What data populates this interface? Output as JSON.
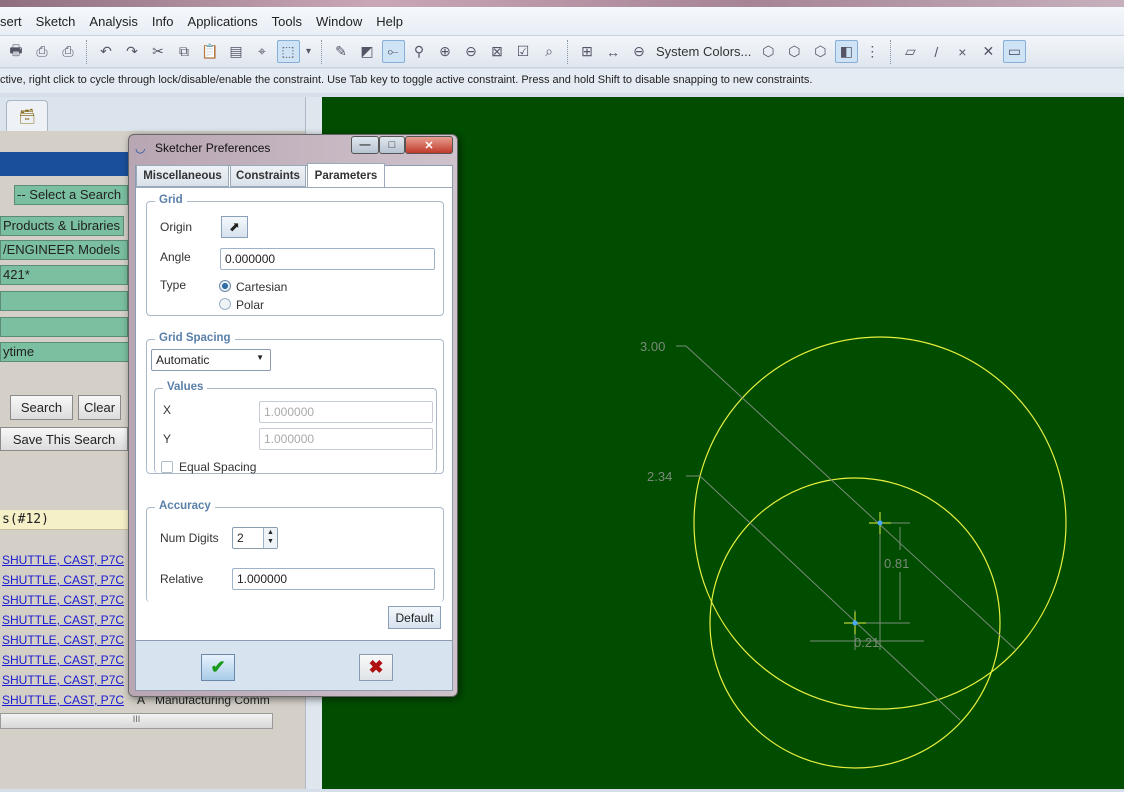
{
  "menu": [
    "sert",
    "Sketch",
    "Analysis",
    "Info",
    "Applications",
    "Tools",
    "Window",
    "Help"
  ],
  "toolbar": {
    "group1": [
      "print-icon",
      "attach-icon",
      "print-preview-icon"
    ],
    "group2": [
      "undo-icon",
      "redo-icon",
      "cut-icon",
      "copy-icon",
      "paste-icon",
      "paste-special-icon",
      "find-icon",
      "select-box-icon",
      "dropdown-arrow-icon"
    ],
    "group3": [
      "sketch-setup-icon",
      "sketch-view-icon",
      "constraint-icon",
      "find-constraints-icon",
      "zoom-in-icon",
      "zoom-out-icon",
      "refit-icon",
      "windows-icon",
      "zoom-window-icon"
    ],
    "group4": [
      "grid-icon",
      "dimension-icon",
      "ruler-icon"
    ],
    "system_colors": "System Colors...",
    "group5": [
      "wireframe-icon",
      "hidden-line-icon",
      "no-hidden-icon",
      "shading-icon",
      "tree-icon"
    ],
    "group6": [
      "datum-plane-icon",
      "datum-axis-icon",
      "datum-point-icon",
      "csys-icon",
      "annotation-icon"
    ]
  },
  "message": "ctive, right click to cycle through lock/disable/enable the constraint. Use Tab key to toggle active constraint. Press and hold Shift to disable snapping to new constraints.",
  "left_panel": {
    "fields": [
      "-- Select a Search",
      "Products & Libraries",
      "/ENGINEER Models",
      "421*",
      "",
      "",
      "ytime"
    ],
    "search_button": "Search",
    "clear_button": "Clear",
    "save_button": "Save This Search",
    "results_header": "s(#12)",
    "results": [
      "SHUTTLE, CAST, P7C",
      "SHUTTLE, CAST, P7C",
      "SHUTTLE, CAST, P7C",
      "SHUTTLE, CAST, P7C",
      "SHUTTLE, CAST, P7C",
      "SHUTTLE, CAST, P7C",
      "SHUTTLE, CAST, P7C",
      "SHUTTLE, CAST, P7C"
    ],
    "last_row_rev": "A",
    "last_row_type": "Manufacturing Comm",
    "scroll_grip": "III"
  },
  "dialog": {
    "title": "Sketcher Preferences",
    "tabs": [
      "Miscellaneous",
      "Constraints",
      "Parameters"
    ],
    "active_tab": "Parameters",
    "grid": {
      "title": "Grid",
      "origin_label": "Origin",
      "angle_label": "Angle",
      "angle_value": "0.000000",
      "type_label": "Type",
      "type_options": [
        "Cartesian",
        "Polar"
      ],
      "type_selected": "Cartesian"
    },
    "grid_spacing": {
      "title": "Grid Spacing",
      "mode": "Automatic",
      "values_title": "Values",
      "x_label": "X",
      "x_value": "1.000000",
      "y_label": "Y",
      "y_value": "1.000000",
      "equal_spacing_label": "Equal Spacing",
      "equal_spacing_checked": false
    },
    "accuracy": {
      "title": "Accuracy",
      "num_digits_label": "Num Digits",
      "num_digits_value": "2",
      "relative_label": "Relative",
      "relative_value": "1.000000"
    },
    "default_button": "Default"
  },
  "sketch": {
    "dimensions": {
      "large_diameter": "3.00",
      "small_diameter": "2.34",
      "vertical": "0.81",
      "horizontal": "0.21"
    },
    "colors": {
      "background": "#004d00",
      "geometry": "#e8f040",
      "dimension": "#7a8a7a",
      "point": "#4aa8ff"
    }
  }
}
